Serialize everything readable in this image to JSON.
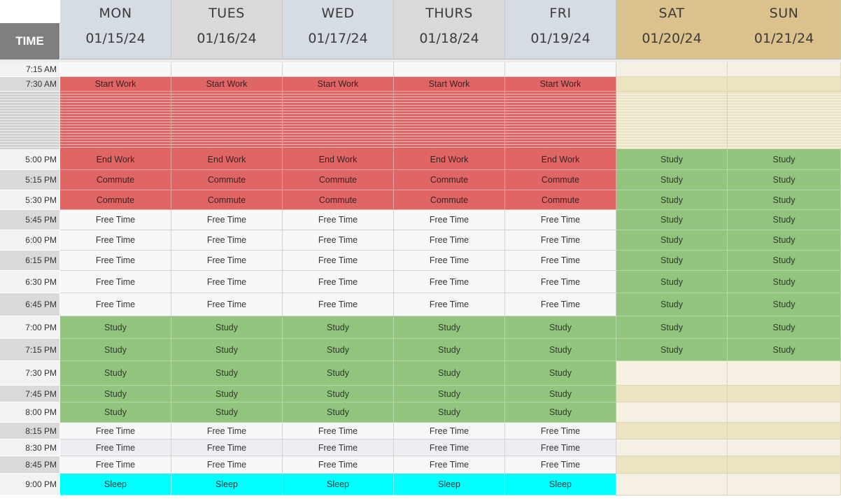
{
  "header": {
    "time_label": "TIME",
    "days": [
      {
        "day": "MON",
        "date": "01/15/24"
      },
      {
        "day": "TUES",
        "date": "01/16/24"
      },
      {
        "day": "WED",
        "date": "01/17/24"
      },
      {
        "day": "THURS",
        "date": "01/18/24"
      },
      {
        "day": "FRI",
        "date": "01/19/24"
      },
      {
        "day": "SAT",
        "date": "01/20/24"
      },
      {
        "day": "SUN",
        "date": "01/21/24"
      }
    ]
  },
  "colors": {
    "weekday_header": "#d6dce4",
    "weekday_header_alt": "#d9d9d9",
    "weekend_header": "#dbc28c",
    "work": "#e06666",
    "study": "#93c47d",
    "sleep": "#00ffff",
    "time_header": "#7f7f7f"
  },
  "rows": [
    {
      "time": "7:15 AM",
      "cells": [
        "",
        "",
        "",
        "",
        "",
        "",
        ""
      ]
    },
    {
      "time": "7:30 AM",
      "cells": [
        "Start Work",
        "Start Work",
        "Start Work",
        "Start Work",
        "Start Work",
        "",
        ""
      ]
    },
    {
      "time": "5:00 PM",
      "cells": [
        "End Work",
        "End Work",
        "End Work",
        "End Work",
        "End Work",
        "Study",
        "Study"
      ]
    },
    {
      "time": "5:15 PM",
      "cells": [
        "Commute",
        "Commute",
        "Commute",
        "Commute",
        "Commute",
        "Study",
        "Study"
      ]
    },
    {
      "time": "5:30 PM",
      "cells": [
        "Commute",
        "Commute",
        "Commute",
        "Commute",
        "Commute",
        "Study",
        "Study"
      ]
    },
    {
      "time": "5:45 PM",
      "cells": [
        "Free Time",
        "Free Time",
        "Free Time",
        "Free Time",
        "Free Time",
        "Study",
        "Study"
      ]
    },
    {
      "time": "6:00 PM",
      "cells": [
        "Free Time",
        "Free Time",
        "Free Time",
        "Free Time",
        "Free Time",
        "Study",
        "Study"
      ]
    },
    {
      "time": "6:15 PM",
      "cells": [
        "Free Time",
        "Free Time",
        "Free Time",
        "Free Time",
        "Free Time",
        "Study",
        "Study"
      ]
    },
    {
      "time": "6:30 PM",
      "cells": [
        "Free Time",
        "Free Time",
        "Free Time",
        "Free Time",
        "Free Time",
        "Study",
        "Study"
      ]
    },
    {
      "time": "6:45 PM",
      "cells": [
        "Free Time",
        "Free Time",
        "Free Time",
        "Free Time",
        "Free Time",
        "Study",
        "Study"
      ]
    },
    {
      "time": "7:00 PM",
      "cells": [
        "Study",
        "Study",
        "Study",
        "Study",
        "Study",
        "Study",
        "Study"
      ]
    },
    {
      "time": "7:15 PM",
      "cells": [
        "Study",
        "Study",
        "Study",
        "Study",
        "Study",
        "Study",
        "Study"
      ]
    },
    {
      "time": "7:30 PM",
      "cells": [
        "Study",
        "Study",
        "Study",
        "Study",
        "Study",
        "",
        ""
      ]
    },
    {
      "time": "7:45 PM",
      "cells": [
        "Study",
        "Study",
        "Study",
        "Study",
        "Study",
        "",
        ""
      ]
    },
    {
      "time": "8:00 PM",
      "cells": [
        "Study",
        "Study",
        "Study",
        "Study",
        "Study",
        "",
        ""
      ]
    },
    {
      "time": "8:15 PM",
      "cells": [
        "Free Time",
        "Free Time",
        "Free Time",
        "Free Time",
        "Free Time",
        "",
        ""
      ]
    },
    {
      "time": "8:30 PM",
      "cells": [
        "Free Time",
        "Free Time",
        "Free Time",
        "Free Time",
        "Free Time",
        "",
        ""
      ]
    },
    {
      "time": "8:45 PM",
      "cells": [
        "Free Time",
        "Free Time",
        "Free Time",
        "Free Time",
        "Free Time",
        "",
        ""
      ]
    },
    {
      "time": "9:00 PM",
      "cells": [
        "Sleep",
        "Sleep",
        "Sleep",
        "Sleep",
        "Sleep",
        "",
        ""
      ]
    }
  ]
}
